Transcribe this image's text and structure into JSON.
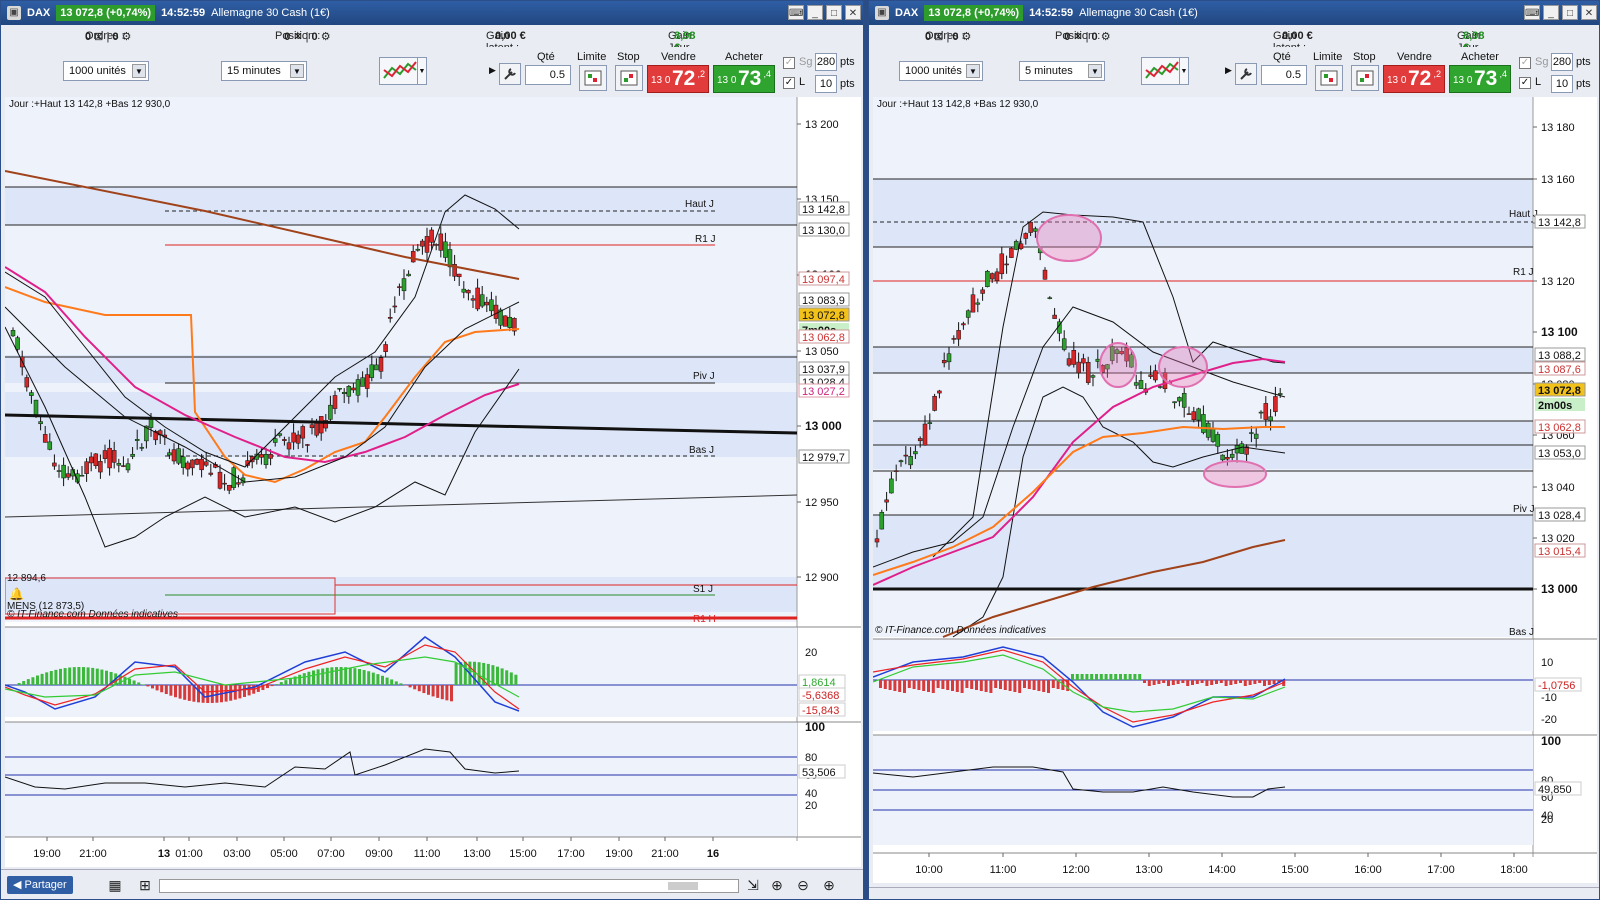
{
  "windows": [
    {
      "id": "L",
      "symbol": "DAX",
      "price_badge": "13 072,8 (+0,74%)",
      "time": "14:52:59",
      "instrument": "Allemagne 30 Cash (1€)",
      "orders_label": "Ordres :",
      "orders_values": "0",
      "orders_values2": "0",
      "position_label": "Position :",
      "position_value": "0",
      "position_value2": "0",
      "gain_latent_label": "Gain latent :",
      "gain_latent": "0,00 €",
      "gain_jour_label": "Gain Jour :",
      "gain_jour": "8,98 €",
      "units": "1000 unités",
      "timeframe": "15 minutes",
      "qty_label": "Qté",
      "qty": "0.5",
      "limite_label": "Limite",
      "stop_label": "Stop",
      "vendre_label": "Vendre",
      "acheter_label": "Acheter",
      "sell_small": "13 0",
      "sell_big": "72",
      "sell_sup": ",2",
      "buy_small": "13 0",
      "buy_big": "73",
      "buy_sup": ",4",
      "sg_label": "Sg",
      "l_label": "L",
      "pts1": "280",
      "pts2": "10",
      "pts_label": "pts",
      "info": "Jour :+Haut 13 142,8 +Bas 12 930,0",
      "footer": "© IT-Finance.com  Données indicatives",
      "mens": "MENS (12 873,5)",
      "level_12894": "12 894,6",
      "price_axis": [
        "13 200",
        "13 150",
        "13 100",
        "13 050",
        "13 000",
        "12 950",
        "12 900"
      ],
      "price_tags": [
        "13 142,8",
        "13 130,0",
        "13 097,4",
        "13 083,9",
        "13 072,8",
        "7m00s",
        "13 062,8",
        "13 037,9",
        "13 028,4",
        "13 027,2",
        "12 979,7"
      ],
      "line_labels": [
        "Haut J",
        "R1 J",
        "Piv J",
        "Bas J",
        "S1 J",
        "R1 H"
      ],
      "macd_axis": [
        "20",
        "-20"
      ],
      "macd_tags": [
        "1,8614",
        "-5,6368",
        "-15,843"
      ],
      "rsi_axis": [
        "100",
        "80",
        "60",
        "40",
        "20"
      ],
      "rsi_tag": "53,506",
      "time_axis": [
        "19:00",
        "21:00",
        "13",
        "01:00",
        "03:00",
        "05:00",
        "07:00",
        "09:00",
        "11:00",
        "13:00",
        "15:00",
        "17:00",
        "19:00",
        "21:00",
        "16"
      ],
      "share_label": "Partager"
    },
    {
      "id": "R",
      "symbol": "DAX",
      "price_badge": "13 072,8 (+0,74%)",
      "time": "14:52:59",
      "instrument": "Allemagne 30 Cash (1€)",
      "orders_label": "Ordres :",
      "orders_values": "0",
      "orders_values2": "0",
      "position_label": "Position :",
      "position_value": "0",
      "position_value2": "0",
      "gain_latent_label": "Gain latent :",
      "gain_latent": "0,00 €",
      "gain_jour_label": "Gain Jour :",
      "gain_jour": "8,98 €",
      "units": "1000 unités",
      "timeframe": "5 minutes",
      "qty_label": "Qté",
      "qty": "0.5",
      "limite_label": "Limite",
      "stop_label": "Stop",
      "vendre_label": "Vendre",
      "acheter_label": "Acheter",
      "sell_small": "13 0",
      "sell_big": "72",
      "sell_sup": ",2",
      "buy_small": "13 0",
      "buy_big": "73",
      "buy_sup": ",4",
      "sg_label": "Sg",
      "l_label": "L",
      "pts1": "280",
      "pts2": "10",
      "pts_label": "pts",
      "info": "Jour :+Haut 13 142,8 +Bas 12 930,0",
      "footer": "© IT-Finance.com  Données indicatives",
      "price_axis": [
        "13 180",
        "13 160",
        "13 140",
        "13 120",
        "13 100",
        "13 080",
        "13 060",
        "13 040",
        "13 020",
        "13 000"
      ],
      "price_tags": [
        "13 142,8",
        "13 088,2",
        "13 087,6",
        "13 072,8",
        "2m00s",
        "13 062,8",
        "13 053,0",
        "13 028,4",
        "13 015,4"
      ],
      "line_labels": [
        "Haut J",
        "R1 J",
        "Piv J",
        "Bas J"
      ],
      "macd_axis": [
        "10",
        "-10",
        "-20"
      ],
      "macd_tags": [
        "-1,0756"
      ],
      "rsi_axis": [
        "100",
        "80",
        "60",
        "40",
        "20"
      ],
      "rsi_tag": "49,850",
      "time_axis": [
        "10:00",
        "11:00",
        "12:00",
        "13:00",
        "14:00",
        "15:00",
        "16:00",
        "17:00",
        "18:00"
      ],
      "share_label": "Partager"
    }
  ]
}
